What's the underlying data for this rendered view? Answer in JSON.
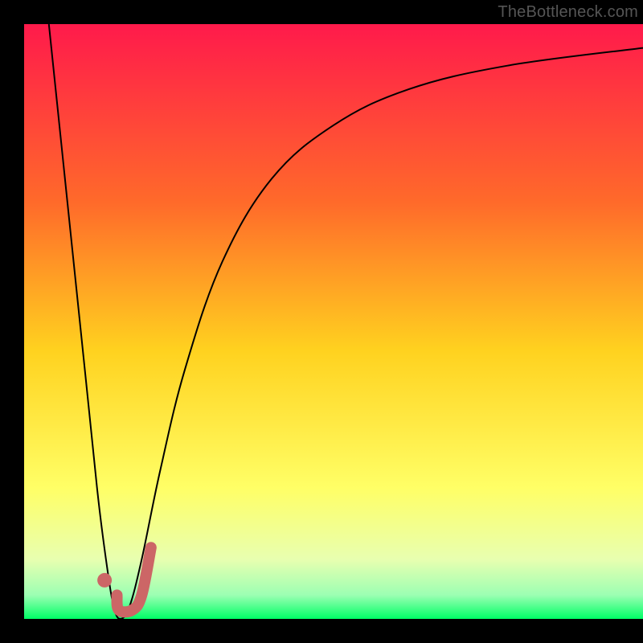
{
  "watermark": "TheBottleneck.com",
  "chart_data": {
    "type": "line",
    "title": "",
    "xlabel": "",
    "ylabel": "",
    "xlim": [
      0,
      100
    ],
    "ylim": [
      0,
      100
    ],
    "gradient_stops": [
      {
        "offset": 0,
        "color": "#ff1a4b"
      },
      {
        "offset": 0.3,
        "color": "#ff6a2a"
      },
      {
        "offset": 0.55,
        "color": "#ffd21f"
      },
      {
        "offset": 0.78,
        "color": "#ffff66"
      },
      {
        "offset": 0.9,
        "color": "#e8ffb0"
      },
      {
        "offset": 0.96,
        "color": "#9cffb3"
      },
      {
        "offset": 1.0,
        "color": "#00ff66"
      }
    ],
    "series": [
      {
        "name": "bottleneck-curve",
        "type": "line",
        "color": "#000000",
        "stroke_width": 2,
        "points": [
          {
            "x": 4.0,
            "y": 100.0
          },
          {
            "x": 7.0,
            "y": 70.0
          },
          {
            "x": 10.0,
            "y": 40.0
          },
          {
            "x": 12.0,
            "y": 20.0
          },
          {
            "x": 13.5,
            "y": 8.0
          },
          {
            "x": 14.5,
            "y": 2.0
          },
          {
            "x": 15.5,
            "y": 0.0
          },
          {
            "x": 17.0,
            "y": 2.0
          },
          {
            "x": 19.0,
            "y": 10.0
          },
          {
            "x": 22.0,
            "y": 25.0
          },
          {
            "x": 26.0,
            "y": 42.0
          },
          {
            "x": 32.0,
            "y": 60.0
          },
          {
            "x": 40.0,
            "y": 74.0
          },
          {
            "x": 50.0,
            "y": 83.0
          },
          {
            "x": 62.0,
            "y": 89.0
          },
          {
            "x": 78.0,
            "y": 93.0
          },
          {
            "x": 100.0,
            "y": 96.0
          }
        ]
      },
      {
        "name": "marker-j-stroke",
        "type": "line",
        "color": "#cc6666",
        "stroke_width": 14,
        "linecap": "round",
        "points": [
          {
            "x": 15.0,
            "y": 4.0
          },
          {
            "x": 15.3,
            "y": 1.5
          },
          {
            "x": 17.5,
            "y": 1.5
          },
          {
            "x": 19.0,
            "y": 4.0
          },
          {
            "x": 20.5,
            "y": 12.0
          }
        ]
      },
      {
        "name": "marker-dot",
        "type": "scatter",
        "color": "#cc6666",
        "radius": 9,
        "points": [
          {
            "x": 13.0,
            "y": 6.5
          }
        ]
      }
    ]
  }
}
